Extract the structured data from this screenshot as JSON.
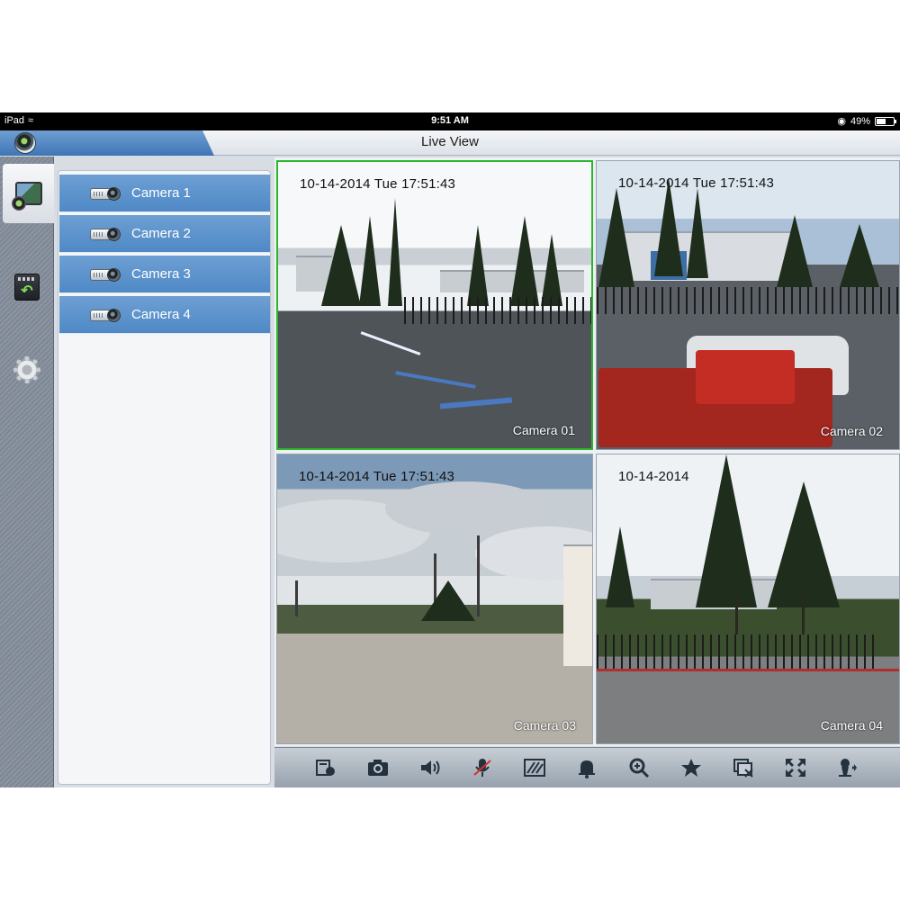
{
  "status_bar": {
    "device": "iPad",
    "time": "9:51 AM",
    "battery": "49%",
    "battery_level": 0.49
  },
  "title_bar": {
    "title": "Live View",
    "logo_icon": "app-camera-lens-icon"
  },
  "rail": {
    "items": [
      {
        "icon": "live-view-icon",
        "active": true
      },
      {
        "icon": "playback-icon",
        "active": false
      },
      {
        "icon": "settings-gear-icon",
        "active": false
      }
    ]
  },
  "camera_list": {
    "items": [
      {
        "label": "Camera 1",
        "icon": "camera-icon"
      },
      {
        "label": "Camera 2",
        "icon": "camera-icon"
      },
      {
        "label": "Camera 3",
        "icon": "camera-icon"
      },
      {
        "label": "Camera 4",
        "icon": "camera-icon"
      }
    ]
  },
  "video_tiles": [
    {
      "timestamp": "10-14-2014  Tue  17:51:43",
      "name": "Camera 01",
      "selected": true
    },
    {
      "timestamp": "10-14-2014  Tue  17:51:43",
      "name": "Camera 02",
      "selected": false
    },
    {
      "timestamp": "10-14-2014  Tue  17:51:43",
      "name": "Camera 03",
      "selected": false
    },
    {
      "timestamp": "10-14-2014",
      "name": "Camera 04",
      "selected": false
    }
  ],
  "toolbar": {
    "buttons": [
      "record-icon",
      "snapshot-icon",
      "audio-icon",
      "talk-microphone-icon",
      "image-settings-icon",
      "alarm-icon",
      "zoom-icon",
      "favorite-star-icon",
      "close-all-icon",
      "fullscreen-icon",
      "ptz-icon"
    ]
  },
  "colors": {
    "accent_blue": "#4f89c6",
    "selected_tile_border": "#2bb52b"
  }
}
